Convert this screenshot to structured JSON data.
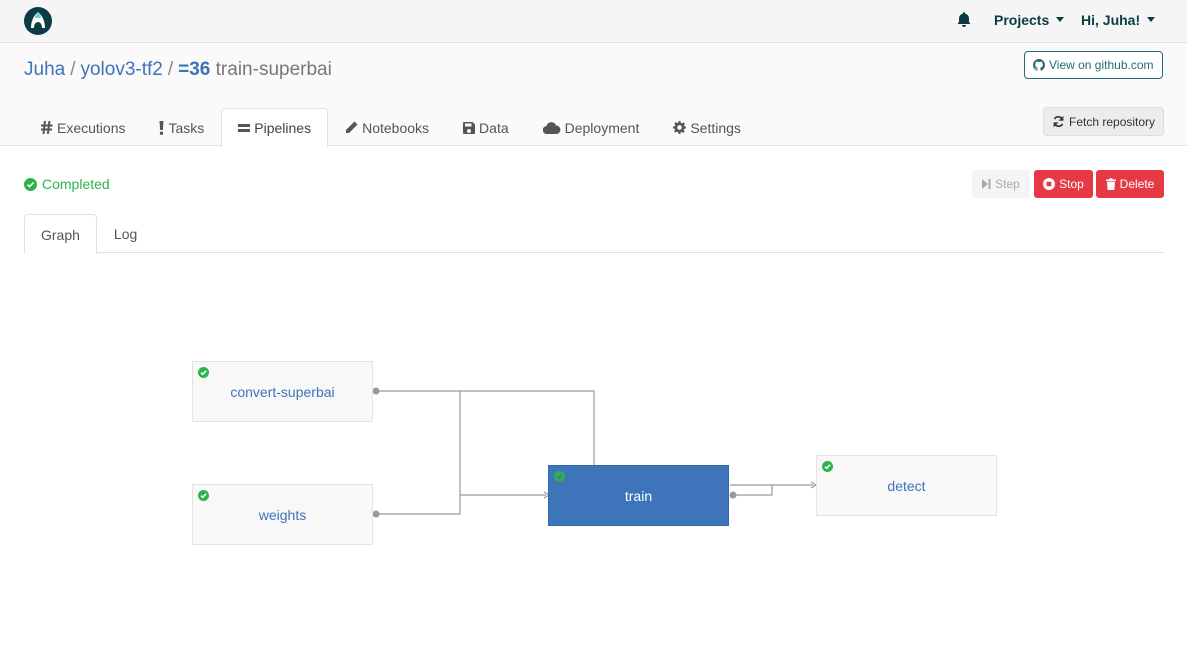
{
  "topbar": {
    "logo": "valohai-logo-icon",
    "notifications_icon": "bell-icon",
    "projects_label": "Projects",
    "user_label": "Hi, Juha!"
  },
  "breadcrumb": {
    "owner": "Juha",
    "project": "yolov3-tf2",
    "pipeline_number": "=36",
    "pipeline_name": "train-superbai"
  },
  "header_buttons": {
    "github": "View on github.com",
    "fetch": "Fetch repository"
  },
  "tabs": [
    {
      "label": "Executions",
      "icon": "hash-icon"
    },
    {
      "label": "Tasks",
      "icon": "exclamation-icon"
    },
    {
      "label": "Pipelines",
      "icon": "equals-icon",
      "active": true
    },
    {
      "label": "Notebooks",
      "icon": "pencil-icon"
    },
    {
      "label": "Data",
      "icon": "floppy-icon"
    },
    {
      "label": "Deployment",
      "icon": "cloud-icon"
    },
    {
      "label": "Settings",
      "icon": "gear-icon"
    }
  ],
  "status": {
    "label": "Completed",
    "color": "#2db34a"
  },
  "actions": {
    "step": "Step",
    "stop": "Stop",
    "delete": "Delete"
  },
  "subtabs": [
    {
      "label": "Graph",
      "active": true
    },
    {
      "label": "Log"
    }
  ],
  "graph": {
    "nodes": [
      {
        "id": "convert-superbai",
        "label": "convert-superbai",
        "status": "completed"
      },
      {
        "id": "weights",
        "label": "weights",
        "status": "completed"
      },
      {
        "id": "train",
        "label": "train",
        "status": "completed",
        "selected": true
      },
      {
        "id": "detect",
        "label": "detect",
        "status": "completed"
      }
    ],
    "edges": [
      {
        "from": "convert-superbai",
        "to": "train"
      },
      {
        "from": "weights",
        "to": "train"
      },
      {
        "from": "train",
        "to": "detect"
      }
    ]
  },
  "colors": {
    "accent": "#3d73b9",
    "danger": "#e63946",
    "success": "#2db34a",
    "brand": "#0b3b45"
  }
}
